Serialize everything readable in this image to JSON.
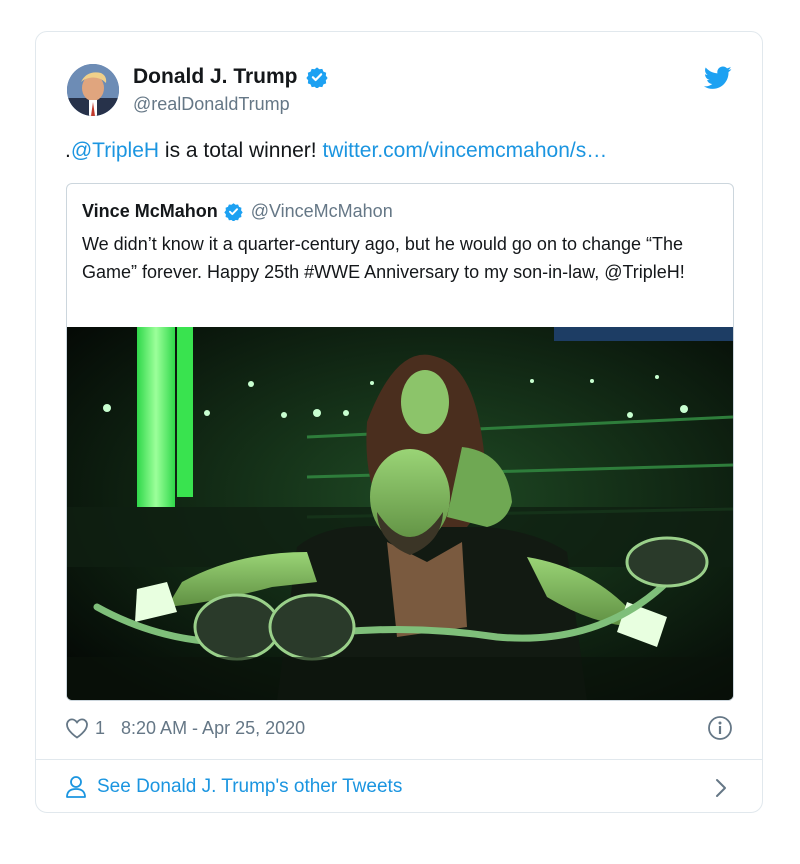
{
  "author": {
    "name": "Donald J. Trump",
    "handle": "@realDonaldTrump"
  },
  "tweet": {
    "prefix": ".",
    "mention": "@TripleH",
    "body": " is a total winner! ",
    "link": "twitter.com/vincemcmahon/s…"
  },
  "quoted": {
    "name": "Vince McMahon",
    "handle": "@VinceMcMahon",
    "text": "We didn’t know it a quarter-century ago, but he would go on to change “The Game” forever. Happy 25th #WWE Anniversary to my son-in-law, @TripleH!"
  },
  "meta": {
    "likes": "1",
    "timestamp": "8:20 AM - Apr 25, 2020"
  },
  "see_more": "See Donald J. Trump's other Tweets",
  "colors": {
    "accent": "#1b95e0",
    "verified": "#1da1f2",
    "muted": "#657786",
    "border": "#e1e8ed"
  },
  "icons": [
    "verified-badge-icon",
    "twitter-bird-icon",
    "heart-icon",
    "info-icon",
    "person-icon",
    "chevron-right-icon"
  ]
}
